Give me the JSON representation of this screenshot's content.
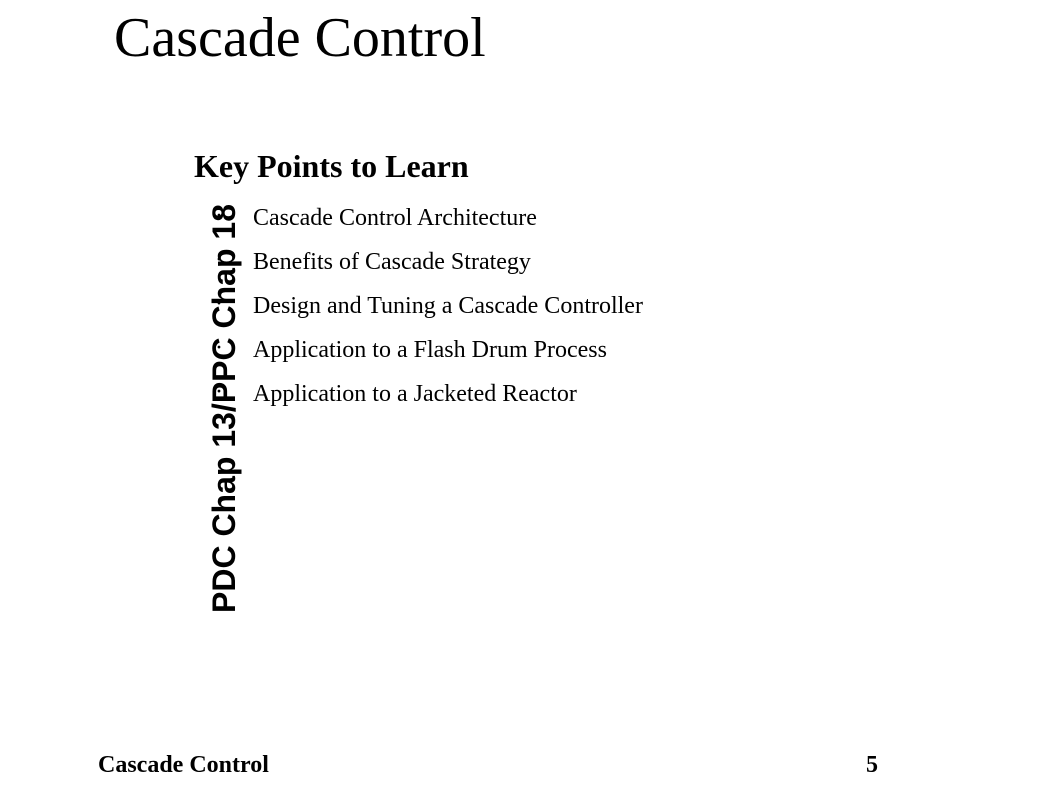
{
  "slide": {
    "title": "Cascade Control",
    "sidebar_label": "PDC Chap 13/PPC Chap 18",
    "section_heading": "Key Points to Learn",
    "bullets": {
      "0": "Cascade Control Architecture",
      "1": "Benefits of Cascade Strategy",
      "2": "Design and Tuning a Cascade Controller",
      "3": "Application to a Flash Drum Process",
      "4": "Application to a Jacketed Reactor"
    },
    "footer_left": "Cascade Control",
    "footer_right": "5"
  }
}
